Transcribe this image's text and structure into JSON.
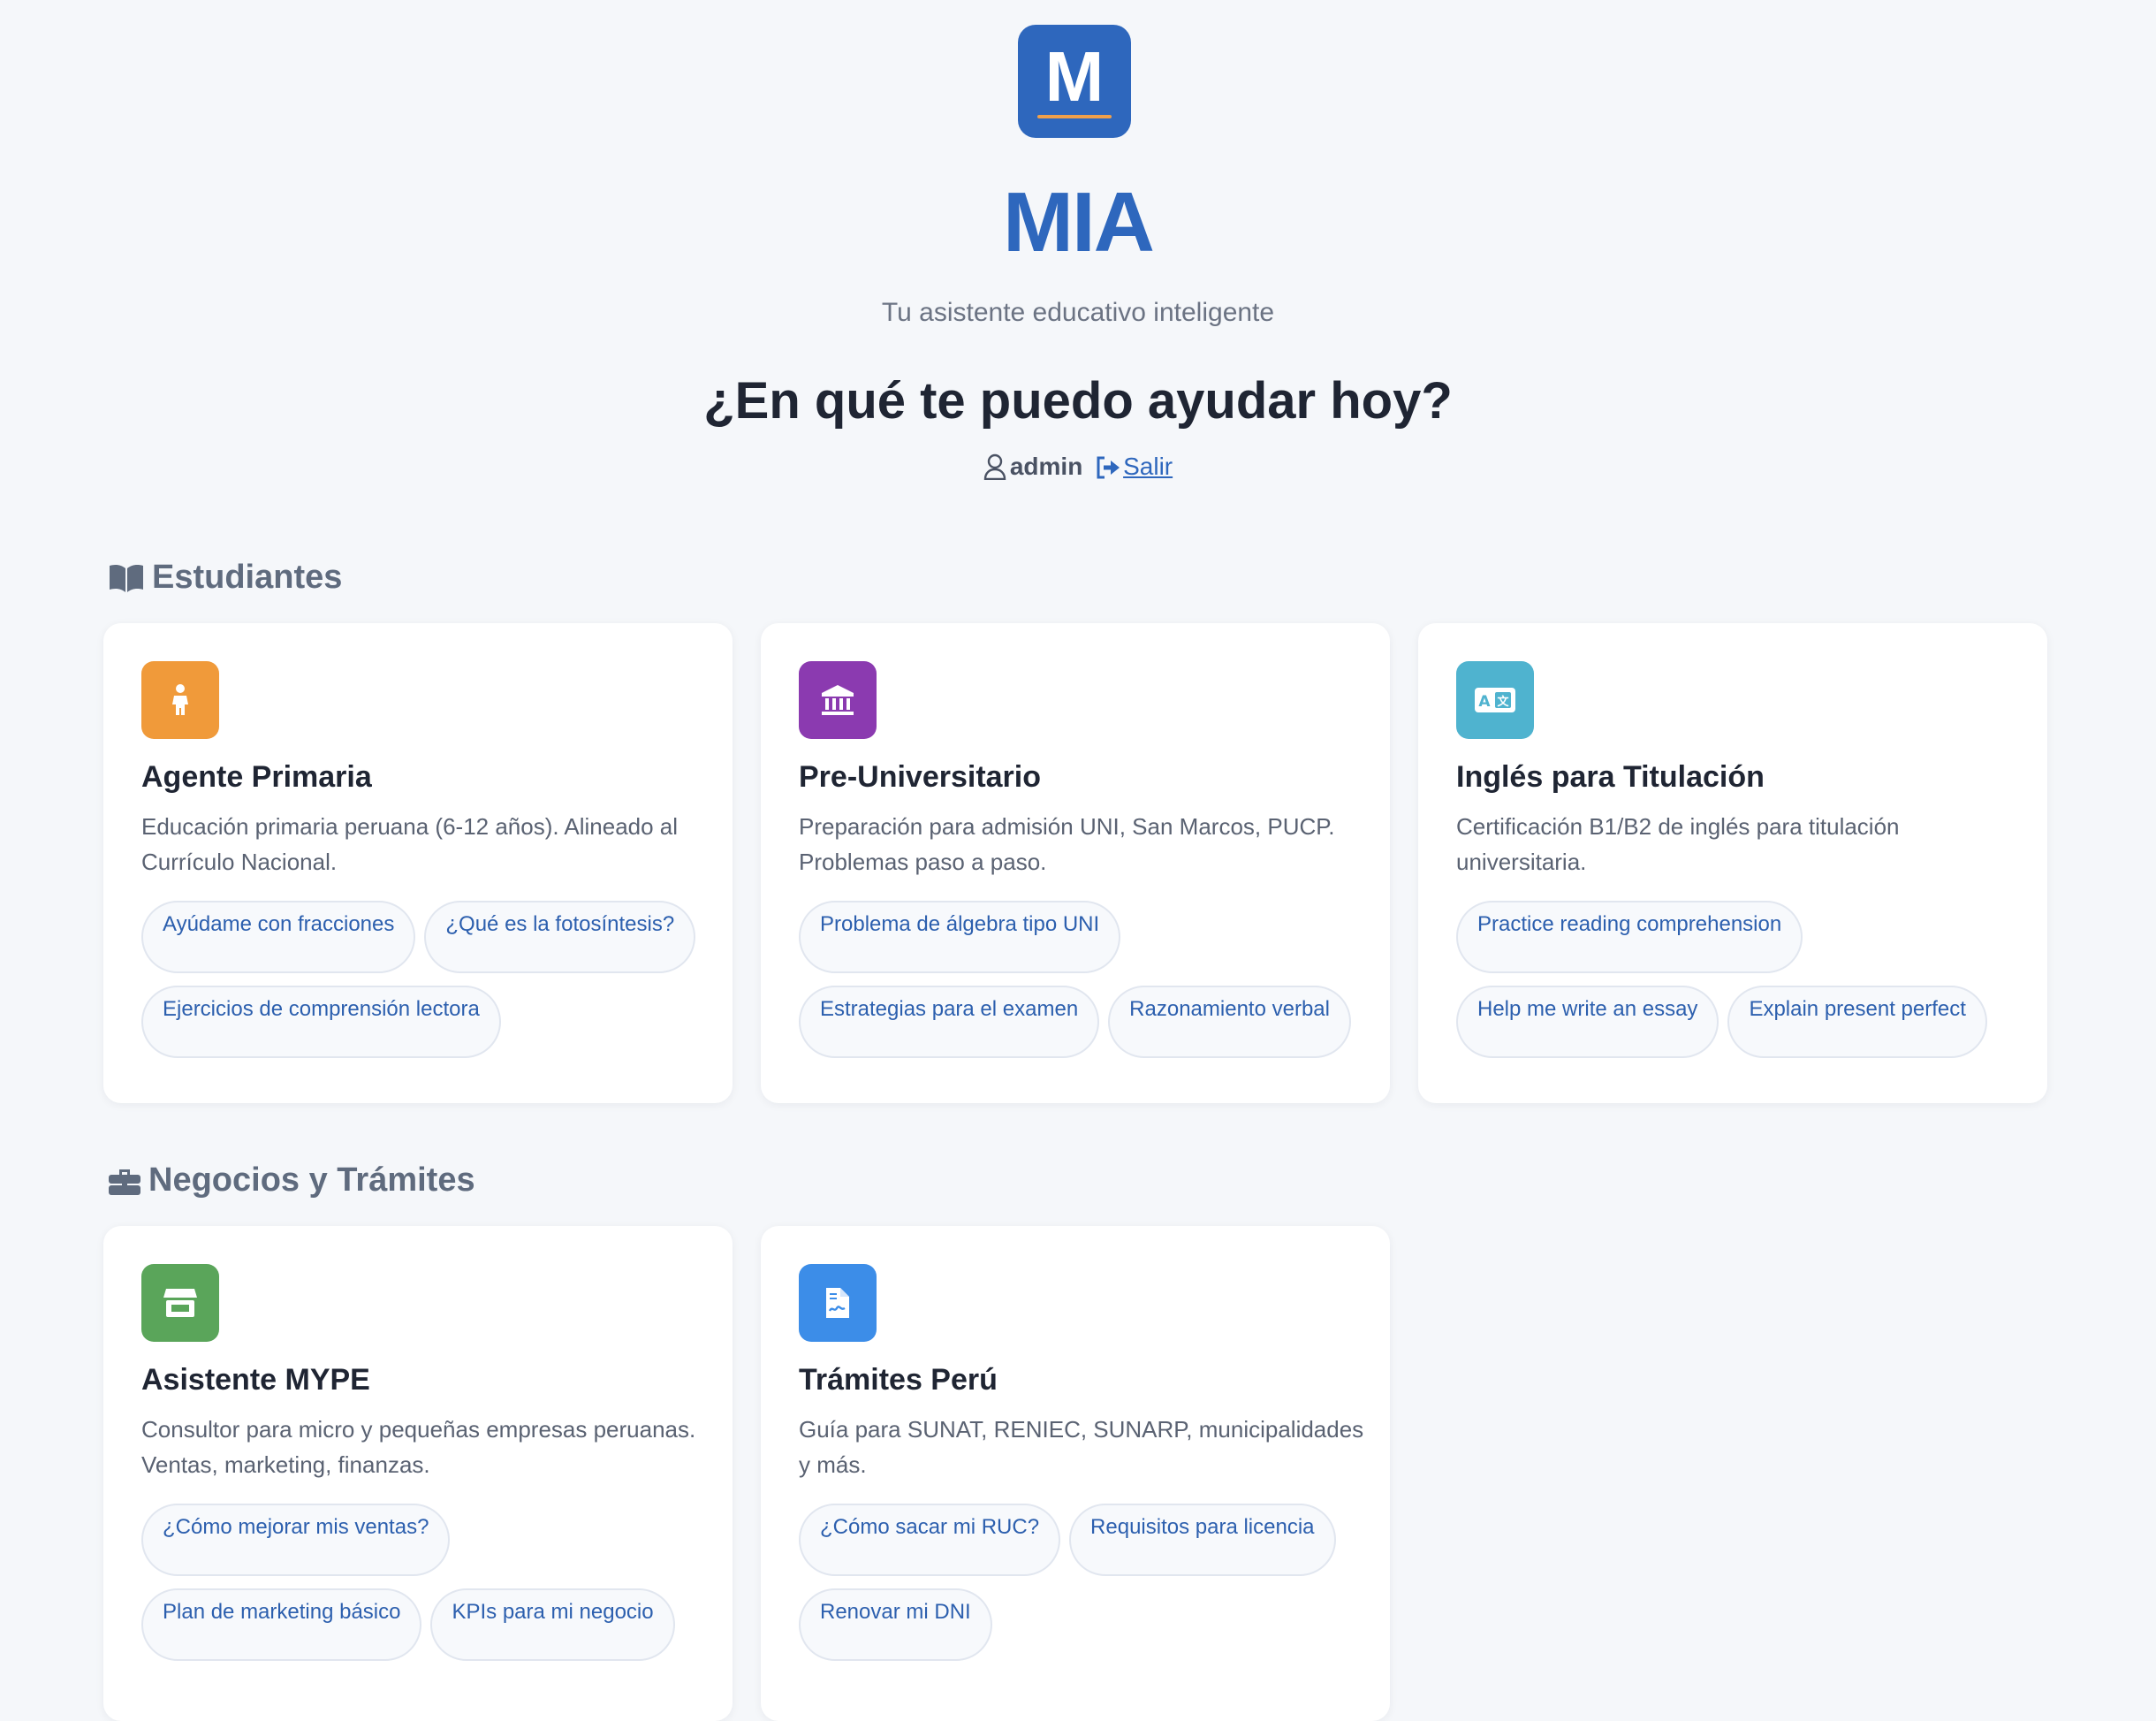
{
  "brand": {
    "logo_letter": "M",
    "title": "MIA",
    "subtitle": "Tu asistente educativo inteligente",
    "accent_color": "#2e67bd"
  },
  "prompt": {
    "question": "¿En qué te puedo ayudar hoy?"
  },
  "user": {
    "username": "admin",
    "logout_label": "Salir"
  },
  "sections": [
    {
      "title": "Estudiantes",
      "icon": "book-open-icon",
      "cards": [
        {
          "title": "Agente Primaria",
          "icon": "child-icon",
          "icon_color": "#f09a3a",
          "description": "Educación primaria peruana (6-12 años). Alineado al Currículo Nacional.",
          "chips": [
            "Ayúdame con fracciones",
            "¿Qué es la fotosíntesis?",
            "Ejercicios de comprensión lectora"
          ]
        },
        {
          "title": "Pre-Universitario",
          "icon": "university-icon",
          "icon_color": "#8b3ab0",
          "description": "Preparación para admisión UNI, San Marcos, PUCP. Problemas paso a paso.",
          "chips": [
            "Problema de álgebra tipo UNI",
            "Estrategias para el examen",
            "Razonamiento verbal"
          ]
        },
        {
          "title": "Inglés para Titulación",
          "icon": "language-icon",
          "icon_color": "#4fb3cf",
          "description": "Certificación B1/B2 de inglés para titulación universitaria.",
          "chips": [
            "Practice reading comprehension",
            "Help me write an essay",
            "Explain present perfect"
          ]
        }
      ]
    },
    {
      "title": "Negocios y Trámites",
      "icon": "briefcase-icon",
      "cards": [
        {
          "title": "Asistente MYPE",
          "icon": "store-icon",
          "icon_color": "#5aa55a",
          "description": "Consultor para micro y pequeñas empresas peruanas. Ventas, marketing, finanzas.",
          "chips": [
            "¿Cómo mejorar mis ventas?",
            "Plan de marketing básico",
            "KPIs para mi negocio"
          ]
        },
        {
          "title": "Trámites Perú",
          "icon": "file-contract-icon",
          "icon_color": "#3c8de8",
          "description": "Guía para SUNAT, RENIEC, SUNARP, municipalidades y más.",
          "chips": [
            "¿Cómo sacar mi RUC?",
            "Requisitos para licencia",
            "Renovar mi DNI"
          ]
        }
      ]
    }
  ]
}
